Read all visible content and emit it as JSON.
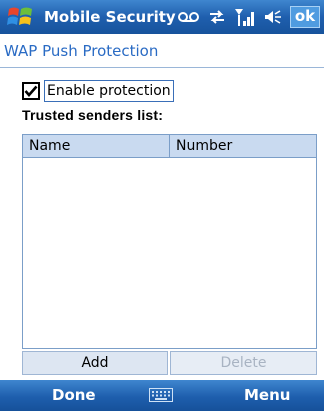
{
  "titlebar": {
    "app_title": "Mobile Security",
    "ok_label": "ok",
    "icons": [
      "windows-start-icon",
      "voicemail-icon",
      "sync-icon",
      "signal-icon",
      "volume-icon"
    ]
  },
  "page": {
    "heading": "WAP Push Protection"
  },
  "settings": {
    "enable_protection": {
      "label": "Enable protection",
      "checked": true
    }
  },
  "trusted_senders": {
    "caption": "Trusted senders list:",
    "columns": [
      "Name",
      "Number"
    ],
    "rows": []
  },
  "buttons": {
    "add_label": "Add",
    "delete_label": "Delete",
    "delete_enabled": false
  },
  "softkeys": {
    "left_label": "Done",
    "right_label": "Menu",
    "center_icon": "keyboard-icon"
  },
  "colors": {
    "titlebar": "#1f5fae",
    "heading_text": "#2a6bc4",
    "list_header": "#c9daf0"
  }
}
